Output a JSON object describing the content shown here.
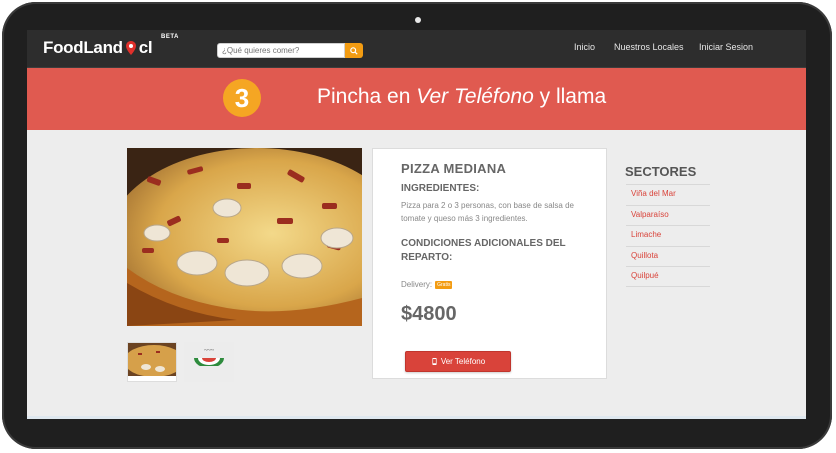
{
  "navbar": {
    "logo_part1": "FoodLand",
    "logo_part2": "cl",
    "beta": "BETA",
    "search_placeholder": "¿Qué quieres comer?",
    "links": [
      "Inicio",
      "Nuestros Locales",
      "Iniciar Sesion"
    ]
  },
  "banner": {
    "step": "3",
    "text_before": "Pincha en ",
    "text_emphasis": "Ver Teléfono",
    "text_after": " y llama"
  },
  "product": {
    "title": "PIZZA MEDIANA",
    "ingredients_label": "INGREDIENTES:",
    "ingredients_text": "Pizza para 2 o 3 personas, con base de salsa de tomate y queso más 3 ingredientes.",
    "conditions_label": "CONDICIONES ADICIONALES DEL REPARTO:",
    "delivery_label": "Delivery:",
    "delivery_badge": "Gratis",
    "price": "$4800",
    "phone_button": "Ver Teléfono"
  },
  "sectors": {
    "title": "SECTORES",
    "items": [
      "Viña del Mar",
      "Valparaíso",
      "Limache",
      "Quillota",
      "Quilpué"
    ]
  },
  "colors": {
    "banner": "#e05a50",
    "accent_orange": "#f5a623",
    "button_red": "#d9433a",
    "navbar": "#2d2d2d"
  }
}
